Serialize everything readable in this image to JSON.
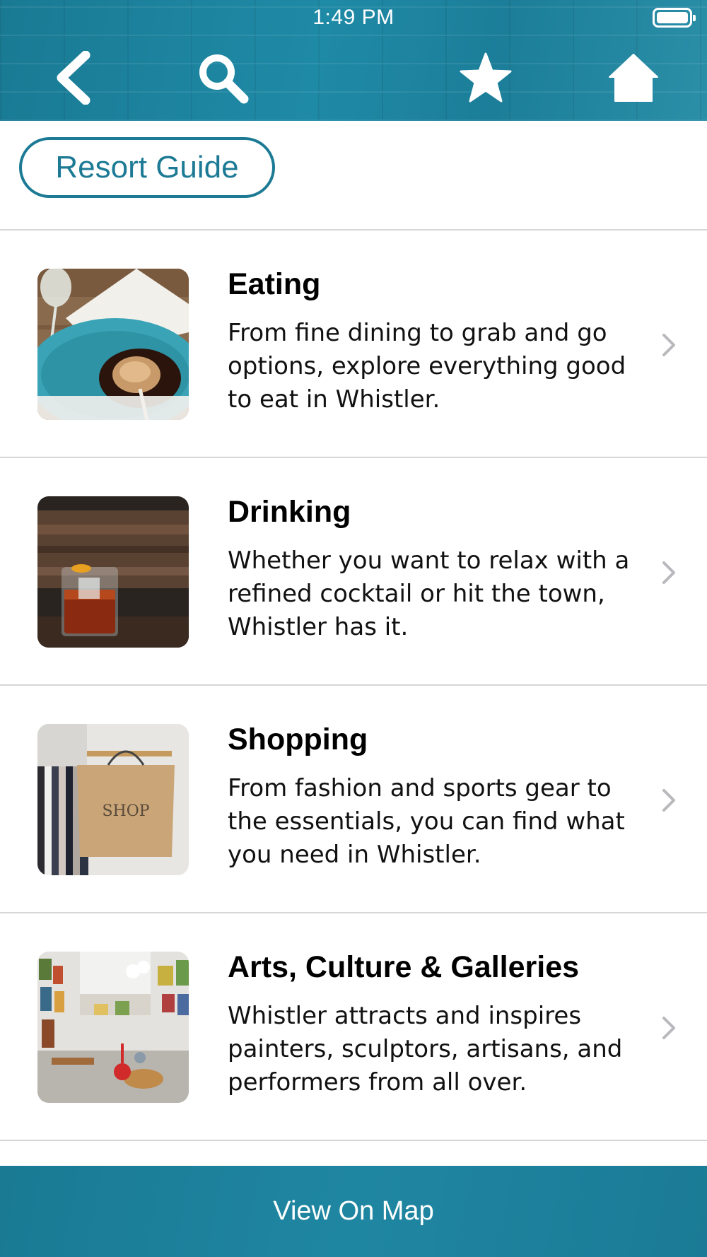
{
  "status_bar": {
    "time": "1:49 PM"
  },
  "header": {
    "icons": [
      "back-icon",
      "search-icon",
      "star-icon",
      "home-icon"
    ]
  },
  "page": {
    "section_label": "Resort Guide"
  },
  "items": [
    {
      "title": "Eating",
      "description": "From fine  dining to grab and go options, explore everything good to eat in Whistler."
    },
    {
      "title": "Drinking",
      "description": "Whether you want to relax with a refined cocktail or hit the town, Whistler has it."
    },
    {
      "title": "Shopping",
      "description": "From fashion and sports gear to the essentials, you can find what you need in Whistler."
    },
    {
      "title": "Arts, Culture & Galleries",
      "description": "Whistler attracts and inspires painters, sculptors, artisans, and performers from all over."
    }
  ],
  "thumb_text": {
    "shop_bag": "SHOP"
  },
  "footer": {
    "label": "View On Map"
  },
  "colors": {
    "accent": "#1c7a95",
    "divider": "#d6d6d6"
  }
}
